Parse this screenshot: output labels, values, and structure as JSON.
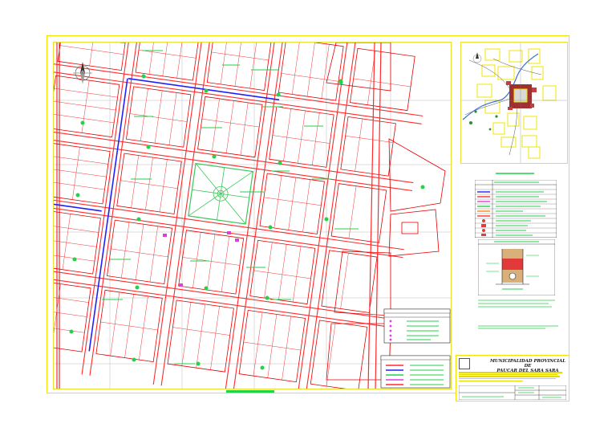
{
  "plan": {
    "title_line1": "MUNICIPALIDAD PROVINCIAL DE",
    "title_line2": "PAUCAR DEL SARA SARA"
  },
  "colors": {
    "frame": "#f2e400",
    "parcels": "#e60000",
    "streets": "#ff2a2a",
    "labels": "#22d24a",
    "water_line": "#2020ff",
    "plaza_green": "#3cc85a",
    "magenta": "#e03ce0"
  },
  "icons": [
    "north-arrow-icon",
    "municipal-logo-icon"
  ]
}
